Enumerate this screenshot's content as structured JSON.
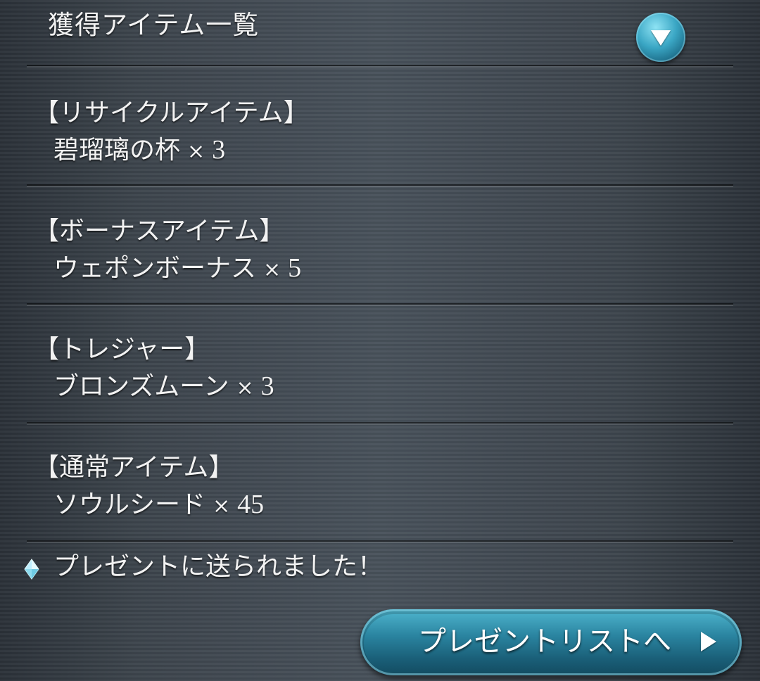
{
  "header": {
    "title": "獲得アイテム一覧",
    "collapse_icon": "triangle-down-icon"
  },
  "sections": [
    {
      "category": "【リサイクルアイテム】",
      "item": "碧瑠璃の杯",
      "multiplier": "×",
      "quantity": "3"
    },
    {
      "category": "【ボーナスアイテム】",
      "item": "ウェポンボーナス",
      "multiplier": "×",
      "quantity": "5"
    },
    {
      "category": "【トレジャー】",
      "item": "ブロンズムーン",
      "multiplier": "×",
      "quantity": "3"
    },
    {
      "category": "【通常アイテム】",
      "item": "ソウルシード",
      "multiplier": "×",
      "quantity": "45"
    }
  ],
  "notice": {
    "icon": "crystal-icon",
    "text": "プレゼントに送られました！"
  },
  "footer": {
    "button_label": "プレゼントリストへ",
    "button_icon": "triangle-right-icon"
  },
  "colors": {
    "background": "#3f474f",
    "accent": "#2a84a0",
    "text": "#f2f2f2"
  }
}
